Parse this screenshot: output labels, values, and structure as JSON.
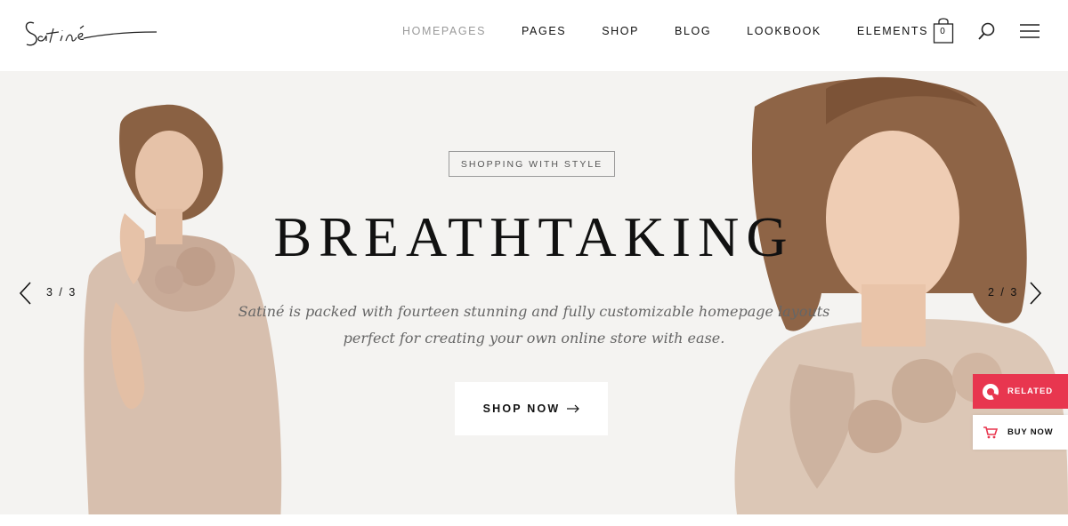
{
  "header": {
    "logo_text": "Satiné",
    "nav": [
      {
        "label": "HOMEPAGES",
        "active": true
      },
      {
        "label": "PAGES",
        "active": false
      },
      {
        "label": "SHOP",
        "active": false
      },
      {
        "label": "BLOG",
        "active": false
      },
      {
        "label": "LOOKBOOK",
        "active": false
      },
      {
        "label": "ELEMENTS",
        "active": false
      }
    ],
    "cart_count": "0",
    "icons": [
      "shopping-bag-icon",
      "search-icon",
      "hamburger-menu-icon"
    ]
  },
  "hero": {
    "tagline": "SHOPPING WITH STYLE",
    "headline": "BREATHTAKING",
    "description_line1": "Satiné is packed with fourteen stunning and fully customizable homepage layouts",
    "description_line2": "perfect for creating your own online store with ease.",
    "cta_label": "SHOP NOW",
    "counter_left": "3 / 3",
    "counter_right": "2 / 3",
    "background_color": "#f4f3f1"
  },
  "widgets": {
    "related_label": "RELATED",
    "buynow_label": "BUY NOW",
    "accent_color": "#e8364f"
  }
}
